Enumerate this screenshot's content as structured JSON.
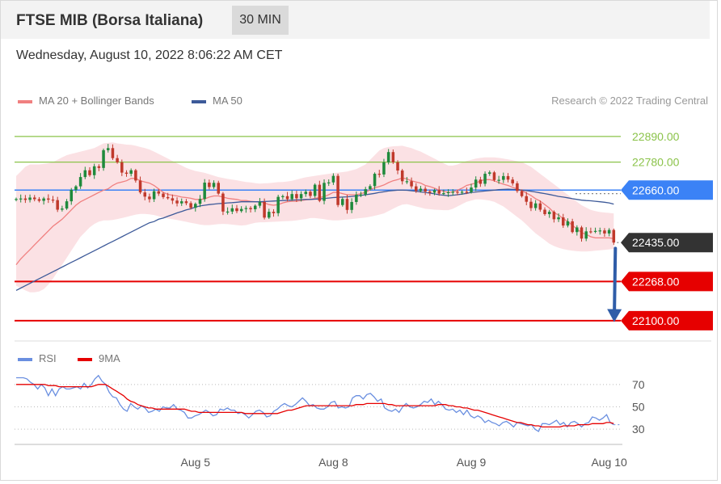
{
  "header": {
    "title": "FTSE MIB (Borsa Italiana)",
    "interval": "30 MIN"
  },
  "timestamp": "Wednesday, August 10, 2022 8:06:22 AM CET",
  "legend": {
    "ma20": "MA 20 + Bollinger Bands",
    "ma50": "MA 50",
    "rsi": "RSI",
    "ma9": "9MA"
  },
  "credit": "Research © 2022 Trading Central",
  "colors": {
    "up": "#1f8a3c",
    "down": "#c0392b",
    "band": "#fadadd",
    "ma20": "#f08080",
    "ma50": "#3d5a99",
    "resistance": "#8bc34a",
    "pivot": "#3b82f6",
    "support": "#e60000",
    "current": "#333333",
    "arrow": "#2f5da8",
    "rsi": "#6a8fe0",
    "ma9": "#e60000"
  },
  "chart_data": [
    {
      "type": "candlestick",
      "ylim": [
        22020,
        22990
      ],
      "x_range": [
        0,
        131
      ],
      "x_ticks": [
        {
          "label": "Aug 5",
          "x": 39
        },
        {
          "label": "Aug 8",
          "x": 69
        },
        {
          "label": "Aug 9",
          "x": 99
        },
        {
          "label": "Aug 10",
          "x": 129
        }
      ],
      "levels": [
        {
          "label": "22890.00",
          "value": 22890,
          "kind": "resistance"
        },
        {
          "label": "22780.00",
          "value": 22780,
          "kind": "resistance"
        },
        {
          "label": "22660.00",
          "value": 22660,
          "kind": "pivot"
        },
        {
          "label": "22435.00",
          "value": 22435,
          "kind": "current"
        },
        {
          "label": "22268.00",
          "value": 22268,
          "kind": "support"
        },
        {
          "label": "22100.00",
          "value": 22100,
          "kind": "support"
        }
      ],
      "close": [
        22622,
        22624,
        22618,
        22628,
        22621,
        22614,
        22624,
        22619,
        22617,
        22576,
        22581,
        22612,
        22661,
        22676,
        22716,
        22745,
        22724,
        22762,
        22755,
        22831,
        22840,
        22797,
        22779,
        22735,
        22730,
        22745,
        22701,
        22650,
        22632,
        22621,
        22655,
        22645,
        22630,
        22625,
        22615,
        22603,
        22612,
        22604,
        22584,
        22601,
        22622,
        22692,
        22673,
        22691,
        22645,
        22568,
        22568,
        22582,
        22570,
        22579,
        22583,
        22578,
        22593,
        22609,
        22542,
        22567,
        22561,
        22631,
        22634,
        22621,
        22643,
        22625,
        22643,
        22653,
        22635,
        22683,
        22614,
        22691,
        22693,
        22721,
        22596,
        22622,
        22575,
        22609,
        22640,
        22641,
        22664,
        22677,
        22730,
        22727,
        22779,
        22823,
        22779,
        22744,
        22698,
        22698,
        22676,
        22656,
        22666,
        22654,
        22649,
        22660,
        22645,
        22647,
        22651,
        22653,
        22650,
        22653,
        22651,
        22671,
        22705,
        22687,
        22730,
        22736,
        22703,
        22704,
        22720,
        22705,
        22689,
        22656,
        22634,
        22610,
        22583,
        22603,
        22576,
        22557,
        22567,
        22535,
        22543,
        22508,
        22526,
        22480,
        22500,
        22452,
        22483,
        22482,
        22485,
        22487,
        22474,
        22489,
        22435
      ],
      "ma20": [
        22340,
        22365,
        22385,
        22405,
        22425,
        22445,
        22465,
        22485,
        22505,
        22520,
        22535,
        22555,
        22575,
        22595,
        22610,
        22620,
        22630,
        22640,
        22650,
        22660,
        22665,
        22680,
        22690,
        22695,
        22700,
        22710,
        22710,
        22700,
        22695,
        22690,
        22680,
        22665,
        22650,
        22642,
        22638,
        22635,
        22630,
        22628,
        22625,
        22620,
        22620,
        22622,
        22630,
        22635,
        22635,
        22630,
        22625,
        22622,
        22620,
        22615,
        22615,
        22612,
        22610,
        22610,
        22605,
        22598,
        22595,
        22598,
        22605,
        22610,
        22612,
        22612,
        22615,
        22618,
        22620,
        22625,
        22628,
        22632,
        22640,
        22650,
        22650,
        22645,
        22640,
        22640,
        22640,
        22645,
        22650,
        22662,
        22670,
        22675,
        22682,
        22692,
        22700,
        22705,
        22712,
        22708,
        22700,
        22695,
        22690,
        22680,
        22675,
        22668,
        22660,
        22655,
        22650,
        22652,
        22660,
        22668,
        22680,
        22685,
        22690,
        22700,
        22705,
        22705,
        22700,
        22692,
        22685,
        22680,
        22672,
        22665,
        22658,
        22647,
        22637,
        22623,
        22613,
        22598,
        22583,
        22563,
        22553,
        22538,
        22525,
        22510,
        22493,
        22478,
        22470,
        22460,
        22455,
        22455,
        22455,
        22455,
        22452
      ],
      "ma50": [
        22230,
        22240,
        22250,
        22260,
        22270,
        22280,
        22290,
        22300,
        22310,
        22320,
        22330,
        22340,
        22350,
        22360,
        22370,
        22380,
        22390,
        22400,
        22410,
        22420,
        22430,
        22440,
        22450,
        22460,
        22470,
        22480,
        22490,
        22500,
        22510,
        22520,
        22525,
        22535,
        22540,
        22548,
        22555,
        22562,
        22568,
        22575,
        22580,
        22587,
        22592,
        22595,
        22598,
        22600,
        22602,
        22603,
        22605,
        22606,
        22608,
        22610,
        22610,
        22610,
        22610,
        22610,
        22611,
        22612,
        22613,
        22614,
        22615,
        22616,
        22617,
        22618,
        22619,
        22620,
        22620,
        22621,
        22622,
        22624,
        22626,
        22628,
        22629,
        22630,
        22631,
        22633,
        22635,
        22637,
        22640,
        22643,
        22646,
        22650,
        22653,
        22656,
        22658,
        22660,
        22660,
        22659,
        22657,
        22655,
        22652,
        22650,
        22647,
        22644,
        22640,
        22638,
        22636,
        22638,
        22640,
        22643,
        22646,
        22650,
        22652,
        22654,
        22656,
        22658,
        22660,
        22662,
        22663,
        22664,
        22663,
        22662,
        22660,
        22658,
        22655,
        22652,
        22648,
        22645,
        22641,
        22637,
        22633,
        22630,
        22627,
        22623,
        22620,
        22617,
        22615,
        22614,
        22612,
        22610,
        22608,
        22605,
        22600
      ],
      "bb_upper": [
        22720,
        22740,
        22760,
        22770,
        22770,
        22770,
        22772,
        22775,
        22780,
        22790,
        22800,
        22810,
        22815,
        22820,
        22825,
        22830,
        22835,
        22840,
        22850,
        22860,
        22862,
        22865,
        22860,
        22858,
        22855,
        22854,
        22850,
        22845,
        22840,
        22834,
        22825,
        22815,
        22805,
        22795,
        22785,
        22775,
        22765,
        22755,
        22748,
        22742,
        22738,
        22734,
        22728,
        22722,
        22716,
        22712,
        22708,
        22705,
        22702,
        22698,
        22695,
        22693,
        22690,
        22688,
        22689,
        22690,
        22692,
        22694,
        22695,
        22697,
        22700,
        22705,
        22710,
        22715,
        22718,
        22721,
        22724,
        22727,
        22730,
        22733,
        22735,
        22737,
        22740,
        22745,
        22750,
        22760,
        22770,
        22790,
        22810,
        22830,
        22840,
        22845,
        22848,
        22849,
        22850,
        22845,
        22840,
        22832,
        22825,
        22815,
        22805,
        22795,
        22785,
        22775,
        22765,
        22765,
        22770,
        22778,
        22785,
        22790,
        22795,
        22798,
        22800,
        22800,
        22800,
        22798,
        22795,
        22792,
        22788,
        22784,
        22780,
        22770,
        22760,
        22745,
        22730,
        22715,
        22700,
        22685,
        22670,
        22655,
        22640,
        22625,
        22610,
        22595,
        22585,
        22575,
        22570,
        22566,
        22564,
        22562,
        22560
      ],
      "bb_lower": [
        22250,
        22240,
        22230,
        22222,
        22222,
        22225,
        22235,
        22255,
        22280,
        22310,
        22340,
        22370,
        22400,
        22430,
        22460,
        22480,
        22500,
        22515,
        22525,
        22530,
        22530,
        22532,
        22536,
        22540,
        22545,
        22550,
        22555,
        22558,
        22558,
        22556,
        22553,
        22548,
        22542,
        22538,
        22535,
        22532,
        22528,
        22524,
        22520,
        22516,
        22512,
        22510,
        22510,
        22512,
        22514,
        22515,
        22514,
        22512,
        22510,
        22508,
        22510,
        22515,
        22520,
        22522,
        22522,
        22523,
        22524,
        22525,
        22526,
        22527,
        22528,
        22530,
        22533,
        22536,
        22540,
        22540,
        22538,
        22535,
        22532,
        22530,
        22530,
        22532,
        22534,
        22536,
        22538,
        22540,
        22542,
        22546,
        22550,
        22555,
        22560,
        22570,
        22580,
        22590,
        22598,
        22600,
        22595,
        22590,
        22585,
        22580,
        22578,
        22576,
        22575,
        22574,
        22574,
        22580,
        22590,
        22600,
        22610,
        22615,
        22620,
        22620,
        22618,
        22615,
        22610,
        22600,
        22590,
        22575,
        22560,
        22545,
        22530,
        22512,
        22493,
        22475,
        22460,
        22445,
        22430,
        22420,
        22413,
        22407,
        22403,
        22400,
        22398,
        22397,
        22397,
        22398,
        22400,
        22402,
        22404,
        22406,
        22408
      ]
    },
    {
      "type": "line",
      "ylim": [
        20,
        80
      ],
      "y_ticks": [
        70,
        50,
        30
      ],
      "x_range": [
        0,
        131
      ],
      "series": [
        {
          "name": "RSI",
          "values": [
            76,
            76,
            76,
            75,
            72,
            70,
            66,
            70,
            67,
            60,
            66,
            60,
            66,
            68,
            66,
            66,
            67,
            68,
            66,
            71,
            67,
            70,
            75,
            78,
            73,
            70,
            63,
            59,
            58,
            52,
            48,
            46,
            53,
            50,
            48,
            51,
            49,
            45,
            46,
            48,
            46,
            50,
            49,
            49,
            52,
            48,
            47,
            45,
            40,
            40,
            42,
            43,
            45,
            47,
            45,
            42,
            43,
            48,
            47,
            49,
            47,
            47,
            44,
            45,
            43,
            40,
            43,
            46,
            47,
            45,
            41,
            42,
            46,
            48,
            51,
            53,
            51,
            50,
            52,
            55,
            58,
            55,
            51,
            52,
            49,
            48,
            48,
            50,
            54,
            55,
            49,
            50,
            49,
            50,
            58,
            60,
            60,
            57,
            61,
            62,
            59,
            55,
            57,
            49,
            47,
            46,
            48,
            45,
            50,
            53,
            50,
            49,
            50,
            52,
            55,
            54,
            57,
            52,
            55,
            52,
            48,
            47,
            48,
            45,
            47,
            43,
            47,
            42,
            40,
            42,
            40,
            36,
            38,
            36,
            35,
            33,
            36,
            37,
            35,
            32,
            36,
            35,
            34,
            33,
            34,
            30,
            28,
            35,
            35,
            34,
            36,
            38,
            34,
            36,
            32,
            36,
            37,
            35,
            32,
            35,
            36,
            41,
            40,
            38,
            40,
            43,
            36,
            34
          ]
        },
        {
          "name": "9MA",
          "values": [
            70,
            70,
            70,
            70,
            70,
            70,
            70,
            70,
            70,
            69,
            69,
            69,
            68,
            68,
            68,
            68,
            68,
            68,
            68,
            68,
            68,
            68,
            69,
            70,
            70,
            70,
            68,
            66,
            64,
            62,
            60,
            57,
            55,
            54,
            52,
            51,
            50,
            49,
            49,
            48,
            48,
            48,
            48,
            48,
            48,
            48,
            48,
            48,
            47,
            46,
            46,
            45,
            45,
            45,
            45,
            45,
            45,
            45,
            45,
            45,
            45,
            45,
            45,
            45,
            44,
            44,
            44,
            44,
            44,
            44,
            44,
            44,
            44,
            44,
            45,
            46,
            47,
            47,
            48,
            49,
            50,
            51,
            51,
            51,
            51,
            51,
            51,
            51,
            51,
            51,
            51,
            51,
            51,
            51,
            51,
            52,
            52,
            52,
            53,
            53,
            53,
            53,
            53,
            53,
            52,
            52,
            51,
            51,
            51,
            51,
            51,
            51,
            51,
            51,
            51,
            51,
            51,
            51,
            52,
            52,
            52,
            51,
            51,
            50,
            50,
            49,
            49,
            48,
            47,
            47,
            46,
            45,
            44,
            43,
            42,
            41,
            40,
            39,
            38,
            37,
            36,
            36,
            35,
            34,
            34,
            33,
            33,
            32,
            32,
            32,
            32,
            32,
            32,
            33,
            33,
            33,
            33,
            34,
            34,
            34,
            34,
            35,
            35,
            35,
            35,
            36,
            36,
            35
          ]
        }
      ],
      "current": 34
    }
  ]
}
